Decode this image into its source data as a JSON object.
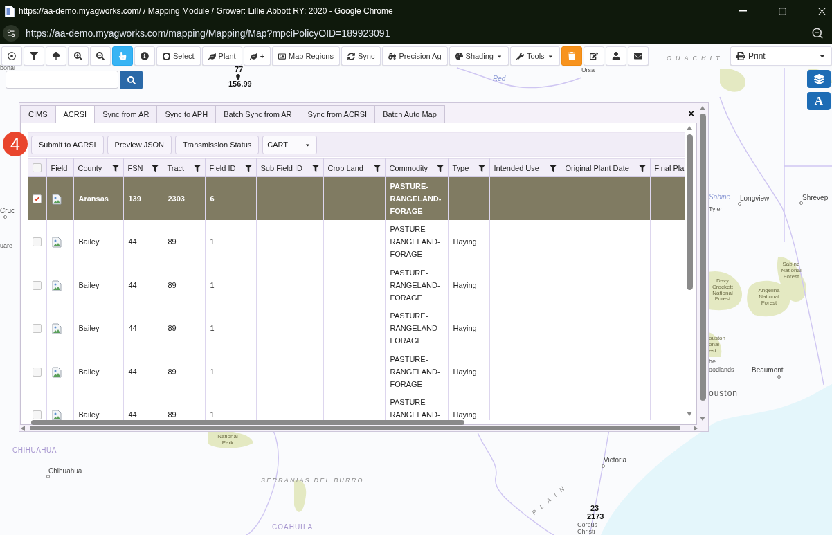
{
  "window": {
    "title": "https://aa-demo.myagworks.com/ / Mapping Module / Grower: Lillie Abbott RY: 2020 - Google Chrome",
    "url": "https://aa-demo.myagworks.com/mapping/Mapping/Map?mpciPolicyOID=189923091"
  },
  "toolbar": [
    {
      "kind": "icon",
      "selected": false
    },
    {
      "kind": "icon",
      "selected": false
    },
    {
      "kind": "icon",
      "selected": false
    },
    {
      "kind": "icon",
      "selected": false
    },
    {
      "kind": "icon",
      "selected": false
    },
    {
      "kind": "icon",
      "selected": true
    },
    {
      "kind": "icon",
      "selected": false
    },
    {
      "kind": "text",
      "label": "Select",
      "selected": false
    },
    {
      "kind": "text",
      "label": "Plant",
      "selected": false
    },
    {
      "kind": "text",
      "label": "+",
      "selected": false
    },
    {
      "kind": "text",
      "label": "Map Regions",
      "selected": false
    },
    {
      "kind": "text",
      "label": "Sync",
      "selected": false
    },
    {
      "kind": "text",
      "label": "Precision Ag",
      "selected": false
    },
    {
      "kind": "menu",
      "label": "Shading",
      "selected": false
    },
    {
      "kind": "menu",
      "label": "Tools",
      "selected": false
    },
    {
      "kind": "alert",
      "selected": false
    },
    {
      "kind": "icon",
      "selected": false
    },
    {
      "kind": "icon",
      "selected": false
    },
    {
      "kind": "icon",
      "selected": false
    }
  ],
  "print": {
    "label": "Print"
  },
  "map_controls": [
    {
      "kind": "icon"
    },
    {
      "kind": "text",
      "label": "A"
    }
  ],
  "map_labels": [
    {
      "text": "bonal",
      "kind": "place"
    },
    {
      "text": "77",
      "kind": "marker"
    },
    {
      "text": "156.99",
      "kind": "marker"
    },
    {
      "text": "Ursa",
      "kind": "place"
    },
    {
      "text": "Red",
      "kind": "river"
    },
    {
      "text": "OUACHIT",
      "kind": "range"
    },
    {
      "text": "Sabine",
      "kind": "river"
    },
    {
      "text": "Longview",
      "kind": "city"
    },
    {
      "text": "Shrevep",
      "kind": "city"
    },
    {
      "text": "Tyler",
      "kind": "place"
    },
    {
      "text": "Sabine National Forest",
      "kind": "forest"
    },
    {
      "text": "Davy Crockett National Forest",
      "kind": "forest"
    },
    {
      "text": "Angelina National Forest",
      "kind": "forest"
    },
    {
      "text": "ouston",
      "kind": "forest"
    },
    {
      "text": "onal",
      "kind": "forest"
    },
    {
      "text": "est",
      "kind": "forest"
    },
    {
      "text": "he",
      "kind": "place"
    },
    {
      "text": "oodlands",
      "kind": "place"
    },
    {
      "text": "Beaumont",
      "kind": "city"
    },
    {
      "text": "ouston",
      "kind": "metro"
    },
    {
      "text": "Cruc",
      "kind": "city"
    },
    {
      "text": "uare",
      "kind": "place"
    },
    {
      "text": "National Park",
      "kind": "forest"
    },
    {
      "text": "CHIHUAHUA",
      "kind": "region"
    },
    {
      "text": "Chihuahua",
      "kind": "city"
    },
    {
      "text": "SERRANIAS DEL BURRO",
      "kind": "range"
    },
    {
      "text": "Victoria",
      "kind": "city"
    },
    {
      "text": "PLAIN",
      "kind": "range"
    },
    {
      "text": "COAHUILA",
      "kind": "region"
    },
    {
      "text": "23",
      "kind": "marker"
    },
    {
      "text": "2173",
      "kind": "marker"
    },
    {
      "text": "Corpus Christi",
      "kind": "place"
    }
  ],
  "step_marker": "4",
  "panel": {
    "tabs": [
      {
        "label": "CIMS",
        "selected": false
      },
      {
        "label": "ACRSI",
        "selected": true
      },
      {
        "label": "Sync from AR",
        "selected": false
      },
      {
        "label": "Sync to APH",
        "selected": false
      },
      {
        "label": "Batch Sync from AR",
        "selected": false
      },
      {
        "label": "Sync from ACRSI",
        "selected": false
      },
      {
        "label": "Batch Auto Map",
        "selected": false
      }
    ],
    "close": "×",
    "actions": [
      {
        "kind": "button",
        "label": "Submit to ACRSI"
      },
      {
        "kind": "button",
        "label": "Preview JSON"
      },
      {
        "kind": "button",
        "label": "Transmission Status"
      },
      {
        "kind": "select",
        "label": "CART"
      }
    ],
    "table": {
      "header_checked": false,
      "columns": [
        {
          "label": "Field",
          "kind": "image",
          "filter": false
        },
        {
          "label": "County",
          "kind": "text",
          "filter": true
        },
        {
          "label": "FSN",
          "kind": "text",
          "filter": true
        },
        {
          "label": "Tract",
          "kind": "text",
          "filter": true
        },
        {
          "label": "Field ID",
          "kind": "text",
          "filter": true
        },
        {
          "label": "Sub Field ID",
          "kind": "text",
          "filter": true
        },
        {
          "label": "Crop Land",
          "kind": "text",
          "filter": true
        },
        {
          "label": "Commodity",
          "kind": "text",
          "filter": true
        },
        {
          "label": "Type",
          "kind": "text",
          "filter": true
        },
        {
          "label": "Intended Use",
          "kind": "text",
          "filter": true
        },
        {
          "label": "Original Plant Date",
          "kind": "text",
          "filter": true
        },
        {
          "label": "Final Pla",
          "kind": "text",
          "filter": false
        }
      ],
      "rows": [
        {
          "selected": true,
          "checked": true,
          "county": "Aransas",
          "fsn": "139",
          "tract": "2303",
          "field_id": "6",
          "commodity": "PASTURE-RANGELAND-FORAGE"
        },
        {
          "selected": false,
          "checked": false,
          "county": "Bailey",
          "fsn": "44",
          "tract": "89",
          "field_id": "1",
          "commodity": "PASTURE-RANGELAND-FORAGE",
          "type": "Haying"
        },
        {
          "selected": false,
          "checked": false,
          "county": "Bailey",
          "fsn": "44",
          "tract": "89",
          "field_id": "1",
          "commodity": "PASTURE-RANGELAND-FORAGE",
          "type": "Haying"
        },
        {
          "selected": false,
          "checked": false,
          "county": "Bailey",
          "fsn": "44",
          "tract": "89",
          "field_id": "1",
          "commodity": "PASTURE-RANGELAND-FORAGE",
          "type": "Haying"
        },
        {
          "selected": false,
          "checked": false,
          "county": "Bailey",
          "fsn": "44",
          "tract": "89",
          "field_id": "1",
          "commodity": "PASTURE-RANGELAND-FORAGE",
          "type": "Haying"
        },
        {
          "selected": false,
          "checked": false,
          "county": "Bailey",
          "fsn": "44",
          "tract": "89",
          "field_id": "1",
          "commodity": "PASTURE-RANGELAND-",
          "type": "Haying"
        }
      ]
    }
  }
}
